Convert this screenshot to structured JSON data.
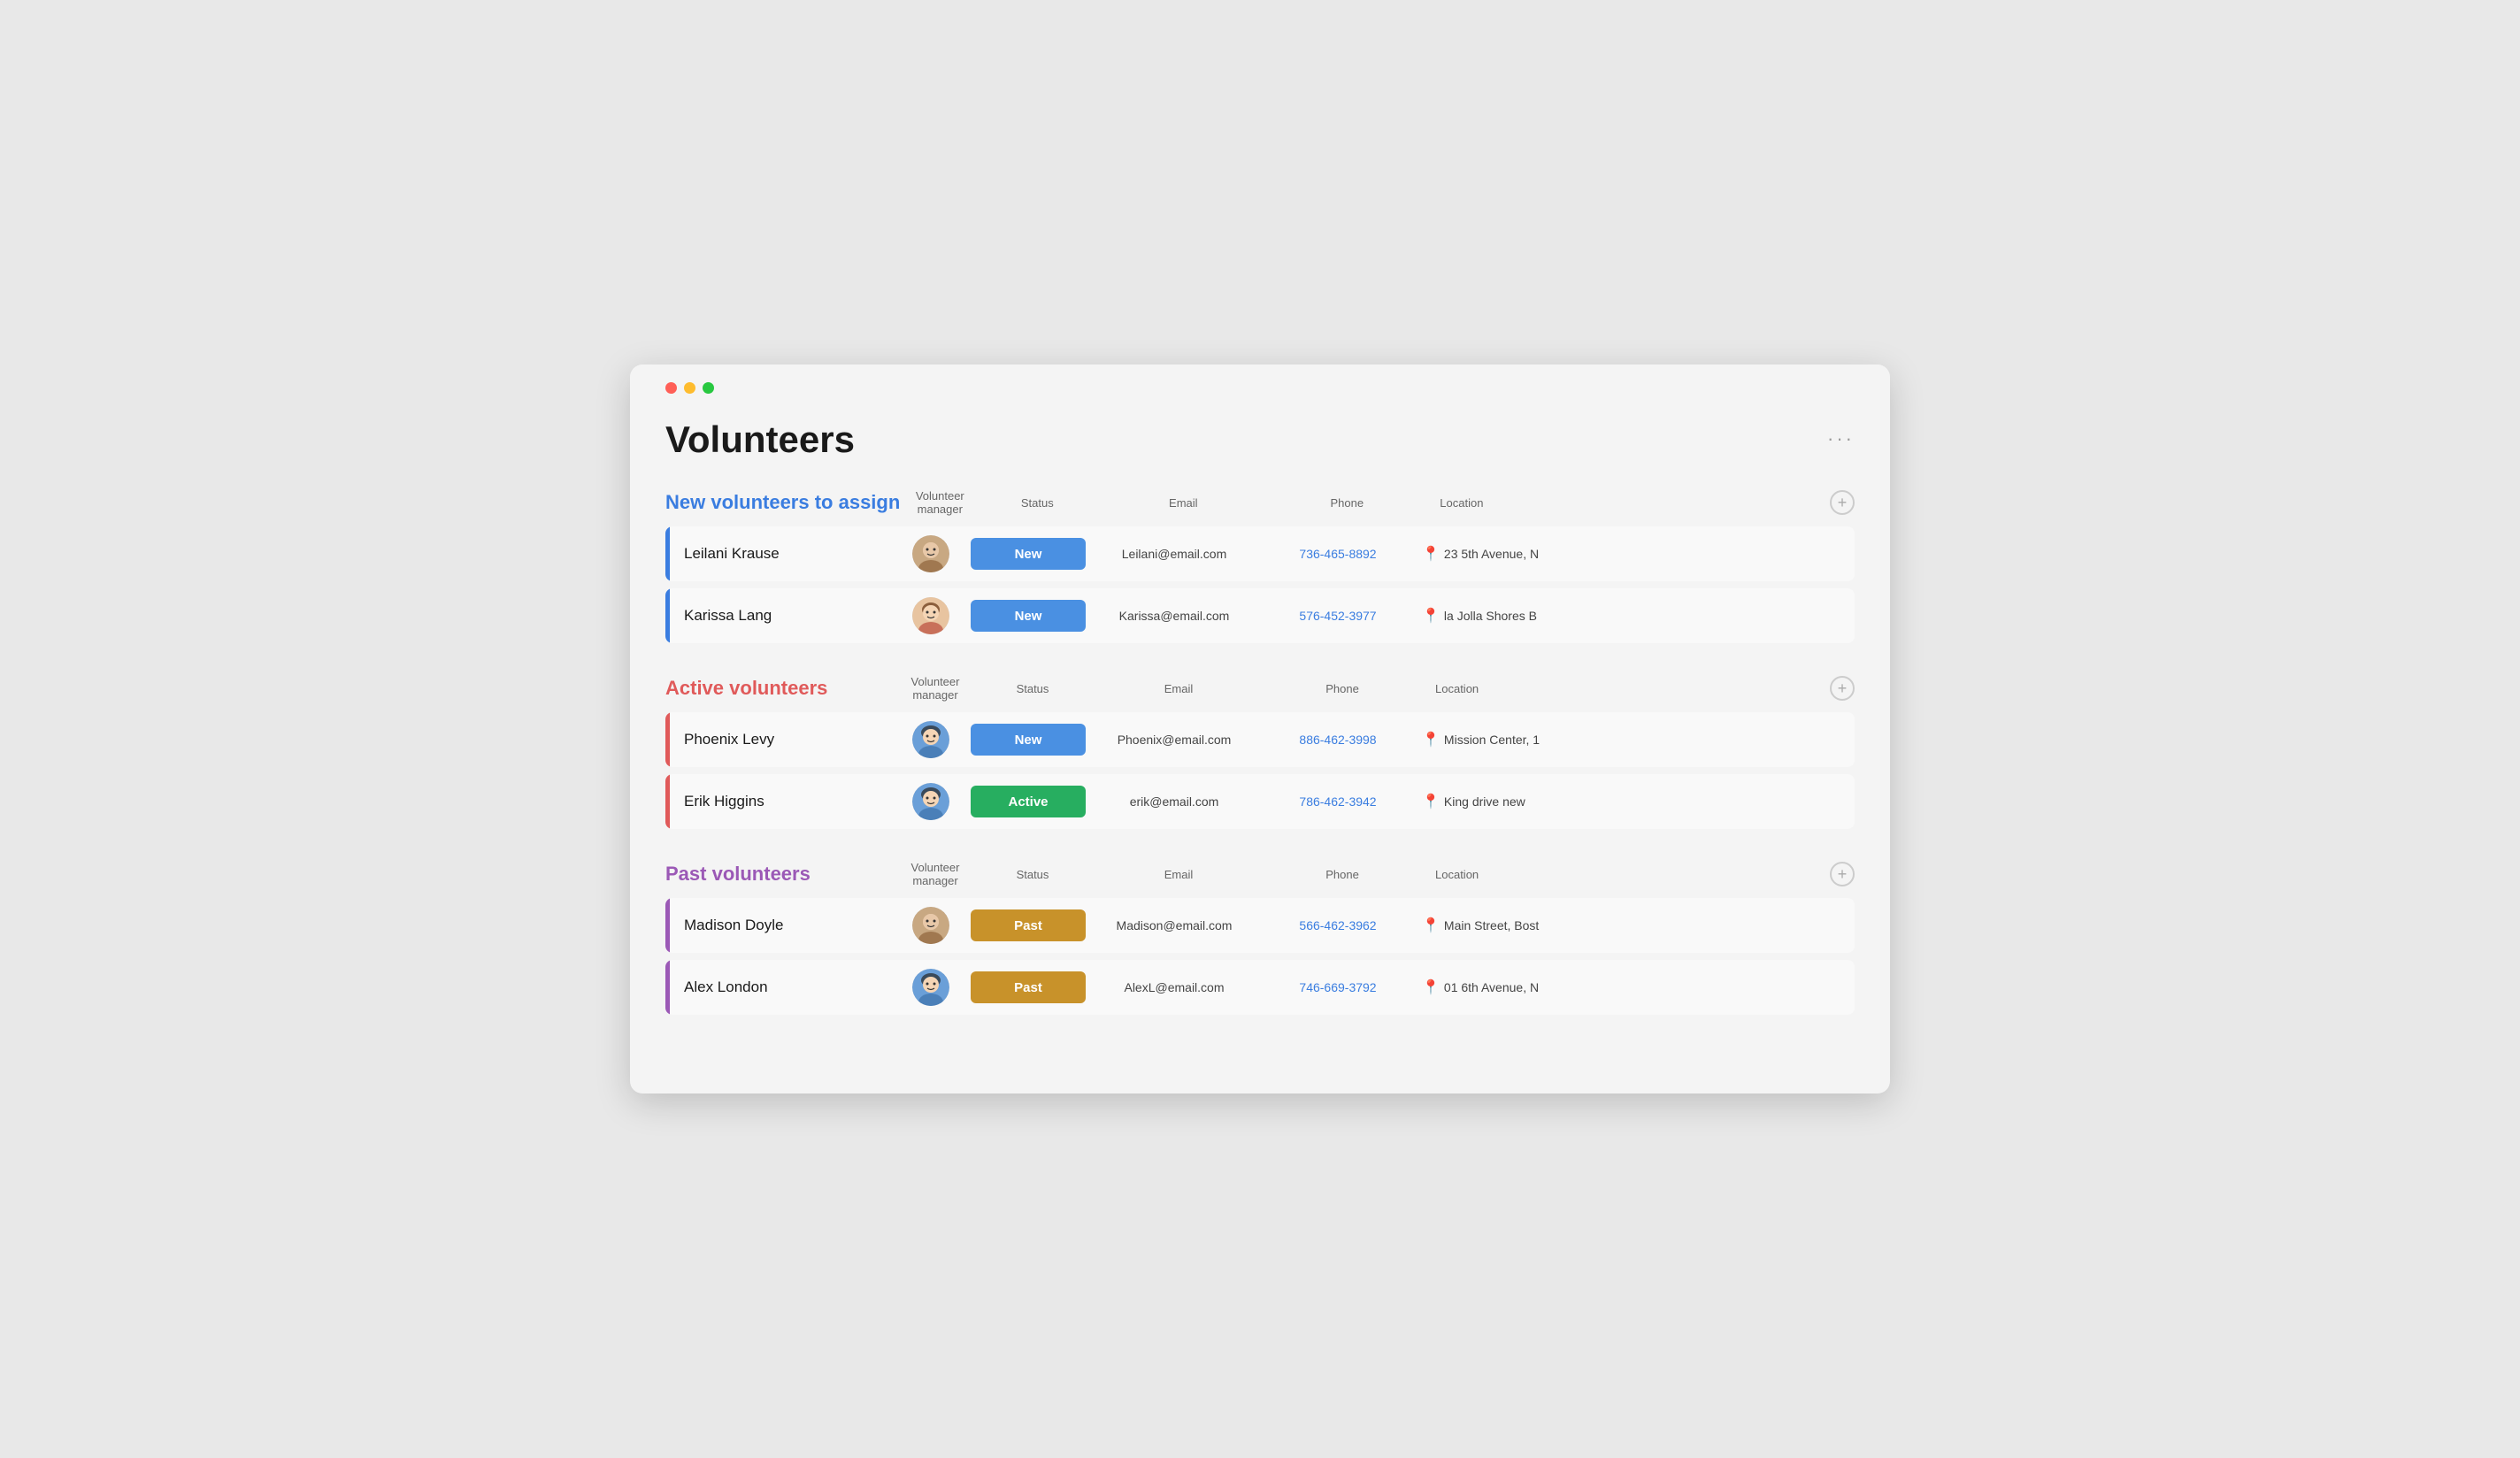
{
  "window": {
    "title": "Volunteers"
  },
  "header": {
    "title": "Volunteers",
    "more_label": "···"
  },
  "sections": [
    {
      "id": "new",
      "title": "New volunteers to assign",
      "title_color": "blue",
      "bar_color": "blue",
      "columns": {
        "manager": "Volunteer manager",
        "status": "Status",
        "email": "Email",
        "phone": "Phone",
        "location": "Location"
      },
      "rows": [
        {
          "name": "Leilani Krause",
          "avatar_type": "male",
          "status": "New",
          "status_class": "status-new",
          "email": "Leilani@email.com",
          "phone": "736-465-8892",
          "location": "23 5th Avenue, N"
        },
        {
          "name": "Karissa Lang",
          "avatar_type": "female",
          "status": "New",
          "status_class": "status-new",
          "email": "Karissa@email.com",
          "phone": "576-452-3977",
          "location": "la Jolla Shores B"
        }
      ]
    },
    {
      "id": "active",
      "title": "Active volunteers",
      "title_color": "red",
      "bar_color": "red",
      "columns": {
        "manager": "Volunteer manager",
        "status": "Status",
        "email": "Email",
        "phone": "Phone",
        "location": "Location"
      },
      "rows": [
        {
          "name": "Phoenix Levy",
          "avatar_type": "female2",
          "status": "New",
          "status_class": "status-new",
          "email": "Phoenix@email.com",
          "phone": "886-462-3998",
          "location": "Mission Center, 1"
        },
        {
          "name": "Erik Higgins",
          "avatar_type": "female2",
          "status": "Active",
          "status_class": "status-active",
          "email": "erik@email.com",
          "phone": "786-462-3942",
          "location": "King drive new"
        }
      ]
    },
    {
      "id": "past",
      "title": "Past volunteers",
      "title_color": "purple",
      "bar_color": "purple",
      "columns": {
        "manager": "Volunteer manager",
        "status": "Status",
        "email": "Email",
        "phone": "Phone",
        "location": "Location"
      },
      "rows": [
        {
          "name": "Madison Doyle",
          "avatar_type": "male",
          "status": "Past",
          "status_class": "status-past",
          "email": "Madison@email.com",
          "phone": "566-462-3962",
          "location": "Main Street, Bost"
        },
        {
          "name": "Alex London",
          "avatar_type": "female2",
          "status": "Past",
          "status_class": "status-past",
          "email": "AlexL@email.com",
          "phone": "746-669-3792",
          "location": "01 6th Avenue, N"
        }
      ]
    }
  ]
}
